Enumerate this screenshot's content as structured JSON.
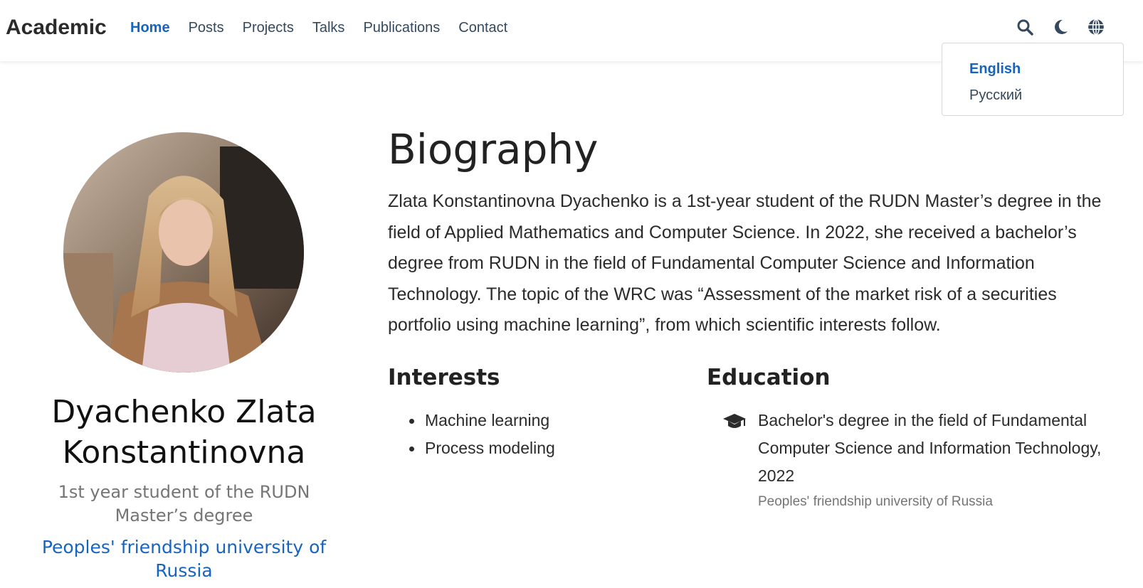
{
  "brand": "Academic",
  "nav": {
    "links": [
      "Home",
      "Posts",
      "Projects",
      "Talks",
      "Publications",
      "Contact"
    ],
    "active": "Home"
  },
  "icons": {
    "search": "search-icon",
    "theme": "moon-icon",
    "language": "globe-icon"
  },
  "language_menu": {
    "items": [
      "English",
      "Русский"
    ],
    "active": "English"
  },
  "profile": {
    "name": "Dyachenko Zlata Konstantinovna",
    "role": "1st year student of the RUDN Master’s degree",
    "organization": "Peoples' friendship university of Russia"
  },
  "biography": {
    "heading": "Biography",
    "text": "Zlata Konstantinovna Dyachenko is a 1st-year student of the RUDN Master’s degree in the field of Applied Mathematics and Computer Science. In 2022, she received a bachelor’s degree from RUDN in the field of Fundamental Computer Science and Information Technology. The topic of the WRC was “Assessment of the market risk of a securities portfolio using machine learning”, from which scientific interests follow."
  },
  "interests": {
    "heading": "Interests",
    "items": [
      "Machine learning",
      "Process modeling"
    ]
  },
  "education": {
    "heading": "Education",
    "items": [
      {
        "icon": "graduation-cap-icon",
        "course": "Bachelor's degree in the field of Fundamental Computer Science and Information Technology, 2022",
        "institution": "Peoples' friendship university of Russia"
      }
    ]
  },
  "colors": {
    "accent": "#1565c0",
    "text": "#2b2b2b",
    "muted": "#757575"
  }
}
